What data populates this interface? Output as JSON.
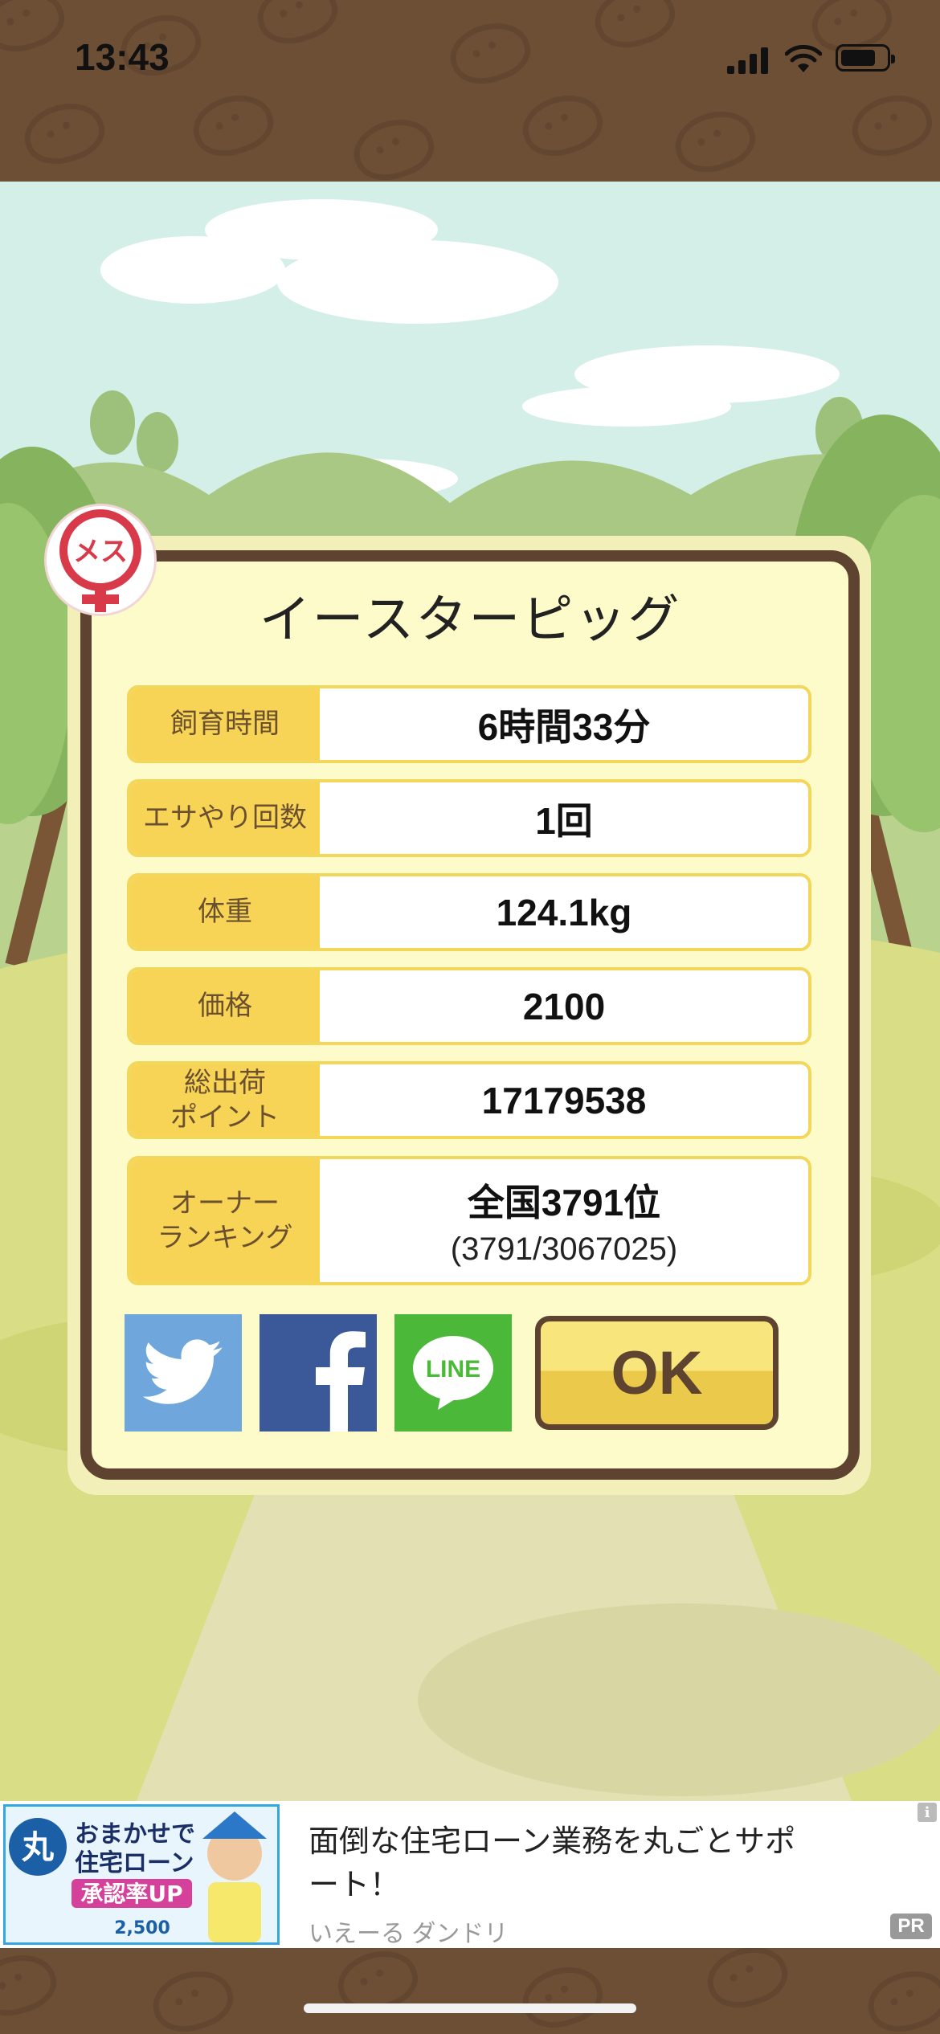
{
  "status_bar": {
    "time": "13:43"
  },
  "badge": {
    "label": "メス"
  },
  "dialog": {
    "title": "イースターピッグ",
    "rows": [
      {
        "label": "飼育時間",
        "value": "6時間33分"
      },
      {
        "label": "エサやり回数",
        "value": "1回"
      },
      {
        "label": "体重",
        "value": "124.1kg"
      },
      {
        "label": "価格",
        "value": "2100"
      },
      {
        "label": "総出荷\nポイント",
        "value": "17179538"
      },
      {
        "label": "オーナー\nランキング",
        "value": "全国3791位",
        "sub": "(3791/3067025)"
      }
    ],
    "share": {
      "line_label": "LINE"
    },
    "ok_label": "OK"
  },
  "ad": {
    "image_text": {
      "line1": "おまかせで",
      "line2": "住宅ローン",
      "line3": "承認率UP",
      "count": "2,500"
    },
    "title": "面倒な住宅ローン業務を丸ごとサポート！",
    "source": "いえーる ダンドリ",
    "pr": "PR",
    "info": "i"
  },
  "colors": {
    "frame_brown": "#5d4330",
    "panel_cream": "#fdfbc9",
    "label_yellow": "#f7d455",
    "twitter": "#6fa7dd",
    "facebook": "#3b5998",
    "line": "#4cb83a"
  }
}
